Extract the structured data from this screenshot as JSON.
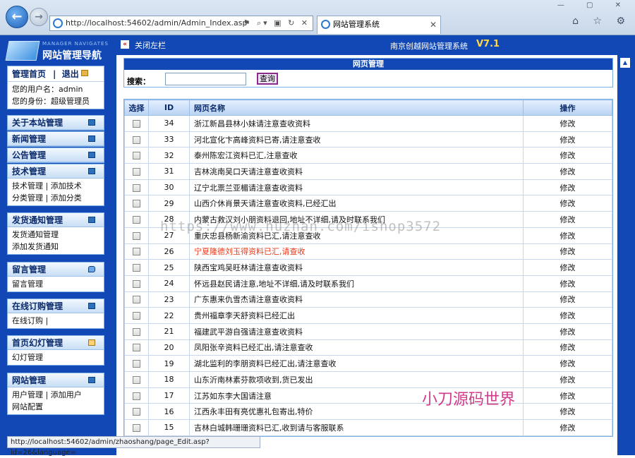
{
  "browser": {
    "address": "http://localhost:54602/admin/Admin_Index.asp",
    "tab_title": "网站管理系统",
    "tab_close": "✕",
    "status_url": "http://localhost:54602/admin/zhaoshang/page_Edit.asp?id=26&language="
  },
  "logo": {
    "subtitle": "MANAGER NAVIGATES",
    "title": "网站管理导航"
  },
  "home_panel": {
    "home": "管理首页",
    "logout": "退出",
    "user_line": "您的用户名：admin",
    "role_line": "您的身份：超级管理员"
  },
  "sidebar": {
    "about": "关于本站管理",
    "news": "新闻管理",
    "notice": "公告管理",
    "tech": {
      "title": "技术管理",
      "l1a": "技术管理",
      "l1b": "添加技术",
      "l2a": "分类管理",
      "l2b": "添加分类"
    },
    "ship": {
      "title": "发货通知管理",
      "l1": "发货通知管理",
      "l2": "添加发货通知"
    },
    "msg": {
      "title": "留言管理",
      "l1": "留言管理"
    },
    "order": {
      "title": "在线订购管理",
      "l1": "在线订购"
    },
    "slide": {
      "title": "首页幻灯管理",
      "l1": "幻灯管理"
    },
    "site": {
      "title": "网站管理",
      "l1a": "用户管理",
      "l1b": "添加用户",
      "l2": "网站配置"
    }
  },
  "topbar": {
    "close_left": "关闭左栏",
    "system_name": "南京创越网站管理系统",
    "version": "V7.1"
  },
  "search": {
    "title": "网页管理",
    "label": "搜索：",
    "button": "查询",
    "value": ""
  },
  "table": {
    "headers": {
      "select": "选择",
      "id": "ID",
      "name": "网页名称",
      "action": "操作"
    },
    "rows": [
      {
        "id": "34",
        "name": "浙江新昌县林小妹请注意查收资料",
        "action": "修改"
      },
      {
        "id": "33",
        "name": "河北宣化卞高峰资料已寄,请注意查收",
        "action": "修改"
      },
      {
        "id": "32",
        "name": "泰州陈宏江资料已汇,注意查收",
        "action": "修改"
      },
      {
        "id": "31",
        "name": "吉林洮南吴口天请注意查收资料",
        "action": "修改"
      },
      {
        "id": "30",
        "name": "辽宁北票兰亚楣请注意查收资料",
        "action": "修改"
      },
      {
        "id": "29",
        "name": "山西介休肖景天请注意查收资料,已经汇出",
        "action": "修改"
      },
      {
        "id": "28",
        "name": "内蒙古救汉刘小朋资料退回,地址不详细,请及时联系我们",
        "action": "修改"
      },
      {
        "id": "27",
        "name": "重庆忠县杨新渝资料已汇,请注意查收",
        "action": "修改"
      },
      {
        "id": "26",
        "name": "宁夏隆德刘玉得资料已汇,请查收",
        "action": "修改",
        "highlight": true
      },
      {
        "id": "25",
        "name": "陕西宝鸡吴旺林请注意查收资料",
        "action": "修改"
      },
      {
        "id": "24",
        "name": "怀远县赵民请注意,地址不详细,请及时联系我们",
        "action": "修改"
      },
      {
        "id": "23",
        "name": "广东惠来仇雪杰请注意查收资料",
        "action": "修改"
      },
      {
        "id": "22",
        "name": "贵州福章李天舒资料已经汇出",
        "action": "修改"
      },
      {
        "id": "21",
        "name": "福建武平游自强请注意查收资料",
        "action": "修改"
      },
      {
        "id": "20",
        "name": "凤阳张辛资料已经汇出,请注意查收",
        "action": "修改"
      },
      {
        "id": "19",
        "name": "湖北监利的李朋资料已经汇出,请注意查收",
        "action": "修改"
      },
      {
        "id": "18",
        "name": "山东沂南林素芬款项收到,货已发出",
        "action": "修改"
      },
      {
        "id": "17",
        "name": "江苏如东李大国请注意",
        "action": "修改"
      },
      {
        "id": "16",
        "name": "江西永丰田有亮优惠礼包寄出,特价",
        "action": "修改"
      },
      {
        "id": "15",
        "name": "吉林白城韩珊珊资料已汇,收到请与客服联系",
        "action": "修改"
      }
    ]
  },
  "overlay": {
    "watermark": "https://www.huzhan.com/ishop3572",
    "brand": "小刀源码世界"
  }
}
